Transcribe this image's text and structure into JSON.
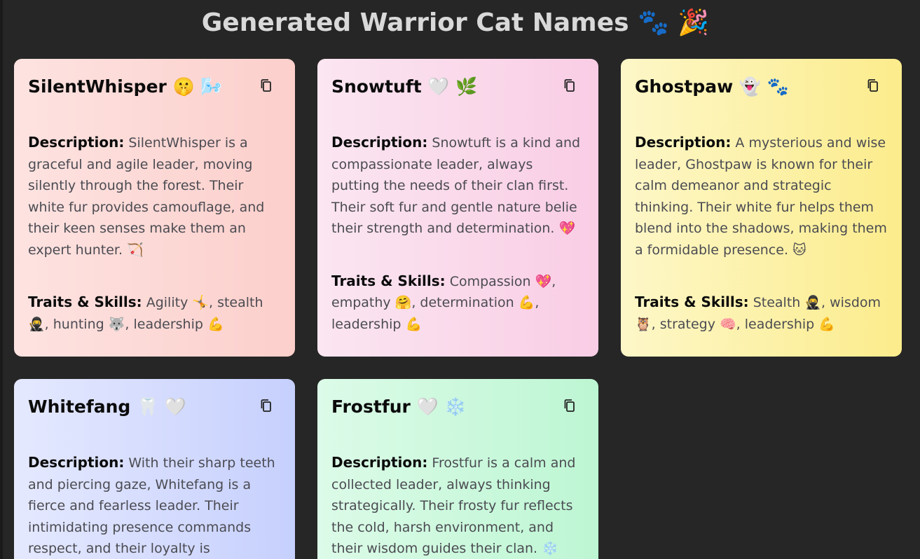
{
  "page": {
    "title": "Generated Warrior Cat Names 🐾 🎉"
  },
  "labels": {
    "description": "Description:",
    "traits": "Traits & Skills:"
  },
  "cards": [
    {
      "name": "SilentWhisper 🤫 🌬️",
      "description": "SilentWhisper is a graceful and agile leader, moving silently through the forest. Their white fur provides camouflage, and their keen senses make them an expert hunter. 🏹",
      "traits": "Agility 🤸, stealth 🥷, hunting 🐺, leadership 💪",
      "color": "#fccfcb"
    },
    {
      "name": "Snowtuft 🤍 🌿",
      "description": "Snowtuft is a kind and compassionate leader, always putting the needs of their clan first. Their soft fur and gentle nature belie their strength and determination. 💖",
      "traits": "Compassion 💖, empathy 🤗, determination 💪, leadership 💪",
      "color": "#f9cde5"
    },
    {
      "name": "Ghostpaw 👻 🐾",
      "description": "A mysterious and wise leader, Ghostpaw is known for their calm demeanor and strategic thinking. Their white fur helps them blend into the shadows, making them a formidable presence. 🐱",
      "traits": "Stealth 🥷, wisdom 🦉, strategy 🧠, leadership 💪",
      "color": "#fcec8c"
    },
    {
      "name": "Whitefang 🦷 🤍",
      "description": "With their sharp teeth and piercing gaze, Whitefang is a fierce and fearless leader. Their intimidating presence commands respect, and their loyalty is unwavering. 🦁",
      "traits": "",
      "color": "#c6d0fd"
    },
    {
      "name": "Frostfur 🤍 ❄️",
      "description": "Frostfur is a calm and collected leader, always thinking strategically. Their frosty fur reflects the cold, harsh environment, and their wisdom guides their clan. ❄️",
      "traits": "",
      "color": "#bdf6d3"
    }
  ]
}
